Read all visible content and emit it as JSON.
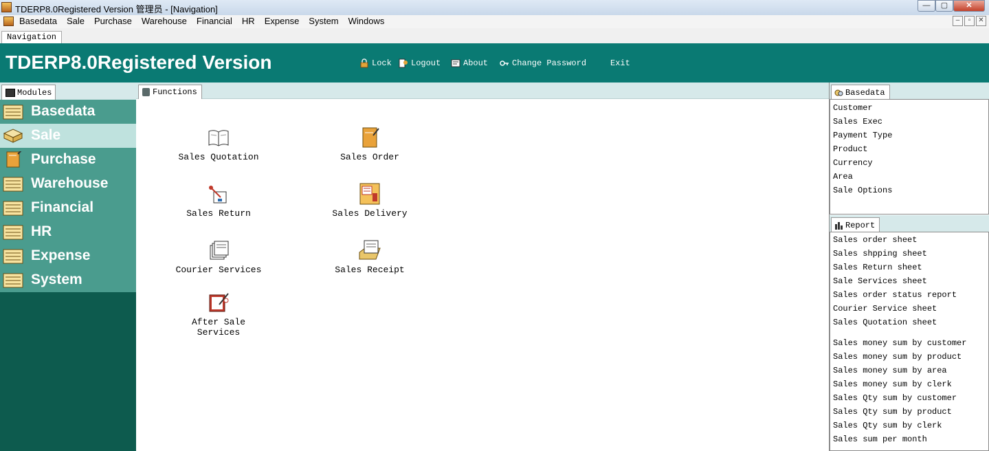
{
  "window": {
    "title": "TDERP8.0Registered Version 管理员 - [Navigation]",
    "controls": [
      "—",
      "▢",
      "✕"
    ]
  },
  "menubar": {
    "items": [
      "Basedata",
      "Sale",
      "Purchase",
      "Warehouse",
      "Financial",
      "HR",
      "Expense",
      "System",
      "Windows"
    ],
    "mdi_controls": [
      "–",
      "▫",
      "✕"
    ]
  },
  "tabs": {
    "navigation": "Navigation"
  },
  "header": {
    "title": "TDERP8.0Registered Version",
    "buttons": {
      "lock": "Lock",
      "logout": "Logout",
      "about": "About",
      "change_password": "Change Password",
      "exit": "Exit"
    }
  },
  "modules": {
    "tab_label": "Modules",
    "items": [
      "Basedata",
      "Sale",
      "Purchase",
      "Warehouse",
      "Financial",
      "HR",
      "Expense",
      "System"
    ],
    "active": "Sale"
  },
  "functions": {
    "tab_label": "Functions",
    "items": {
      "sales_quotation": "Sales Quotation",
      "sales_order": "Sales Order",
      "sales_return": "Sales Return",
      "sales_delivery": "Sales Delivery",
      "courier_services": "Courier Services",
      "sales_receipt": "Sales Receipt",
      "after_sale_line1": "After Sale",
      "after_sale_line2": "Services"
    }
  },
  "basedata_panel": {
    "tab_label": "Basedata",
    "items": [
      "Customer",
      "Sales Exec",
      "Payment Type",
      "Product",
      "Currency",
      "Area",
      "Sale Options"
    ]
  },
  "report_panel": {
    "tab_label": "Report",
    "group1": [
      "Sales order sheet",
      "Sales shpping sheet",
      "Sales Return sheet",
      "Sale Services sheet",
      "Sales order status report",
      "Courier Service sheet",
      "Sales Quotation sheet"
    ],
    "group2": [
      "Sales money sum by customer",
      "Sales money sum by product",
      "Sales money sum by area",
      "Sales money sum by clerk",
      "Sales Qty sum by customer",
      "Sales Qty sum by product",
      "Sales Qty sum by clerk",
      "Sales sum per month"
    ]
  },
  "colors": {
    "header_teal": "#0a7a73",
    "module_bg": "#0d5b4e",
    "module_item": "#4a9c8e",
    "module_active": "#bfe2de",
    "panel_tab_strip": "#d6e9ea"
  }
}
